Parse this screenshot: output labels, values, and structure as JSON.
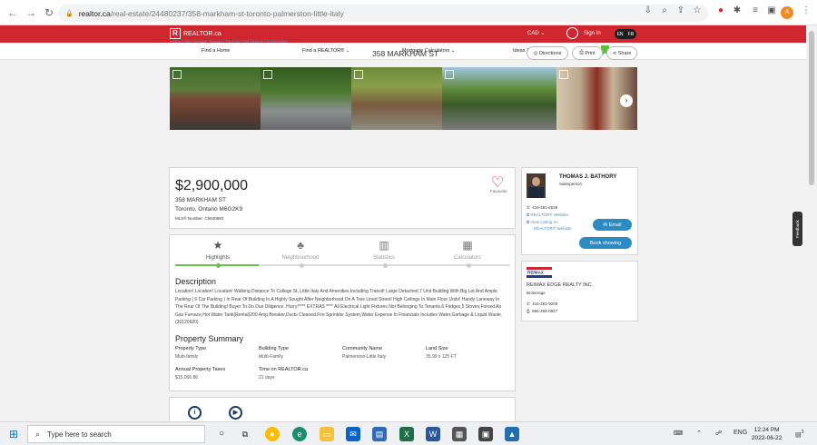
{
  "browser": {
    "url_host": "realtor.ca",
    "url_path": "/real-estate/24480237/358-markham-st-toronto-palmerston-little-italy",
    "profile_initial": "A"
  },
  "header": {
    "logo_text": "REALTOR.ca",
    "logo_letter": "R",
    "currency": "CAD",
    "sign_in": "Sign In",
    "lang_en": "EN",
    "lang_fr": "FR"
  },
  "menu": {
    "items": [
      "Find a Home",
      "Find a REALTOR®",
      "Mortgage Calculators",
      "Ideas & How-to"
    ]
  },
  "breadcrumb": [
    "Home",
    "ON",
    "Greater Toronto",
    "Toronto",
    "Old Toronto",
    "Palmerston"
  ],
  "listing": {
    "title": "358 MARKHAM ST",
    "actions": {
      "directions": "Directions",
      "print": "Print",
      "share": "Share"
    },
    "price": "$2,900,000",
    "address_line1": "358 MARKHAM ST",
    "address_line2": "Toronto, Ontario M6G2K9",
    "mls": "MLS® Number: C5640683",
    "favourite": "Favourite"
  },
  "tabs": [
    {
      "label": "Highlights",
      "icon": "star-icon"
    },
    {
      "label": "Neighbourhood",
      "icon": "trees-icon"
    },
    {
      "label": "Statistics",
      "icon": "bar-chart-icon"
    },
    {
      "label": "Calculators",
      "icon": "calculator-icon"
    }
  ],
  "description": {
    "heading": "Description",
    "text": "Location! Location! Location! Walking Distance To College St, Little Italy And Amenities Including Transit! Large Detached 7 Unit Building With Big Lot And Ample Parking ( 6 Car Parking ) In Rear Of Building In A Highly Sought After Neighborhood On A Tree Lined Street! High Ceilings In Main Floor Units! Handy Laneway In The Rear Of The Building! Buyer To Do Due Diligence. Hurry!**** EXTRAS **** All Electrical Light Fixtures Not Belonging To Tenants,6 Fridges,5 Stoves,Forced Air Gas Furnace,Hot Water Tank(Rental)200 Amp Breaker,Ducts Cleaned.Fire Sprinkler System,Water Expense In Financials Includes Water,Garbage & Liquid Waste. (30120920)"
  },
  "summary": {
    "heading": "Property Summary",
    "items": [
      {
        "label": "Property Type",
        "value": "Multi-family"
      },
      {
        "label": "Building Type",
        "value": "Multi-Family"
      },
      {
        "label": "Community Name",
        "value": "Palmerston-Little Italy"
      },
      {
        "label": "Land Size",
        "value": "35.99 x 125 FT"
      },
      {
        "label": "Annual Property Taxes",
        "value": "$15,066.86"
      },
      {
        "label": "Time on REALTOR.ca",
        "value": "21 days"
      }
    ]
  },
  "agent": {
    "name": "THOMAS J. BATHORY",
    "role": "Salesperson",
    "phone": "416-281-6528",
    "website": "REALTOR® Website",
    "view_listing_1": "View Listing on",
    "view_listing_2": "REALTOR® Website",
    "email_btn": "Email",
    "book_btn": "Book showing"
  },
  "brokerage": {
    "name": "RE/MAX EDGE REALTY INC.",
    "type": "Brokerage",
    "logo_text": "RE/MAX",
    "phone": "416-281-9200",
    "fax": "866-268-0947"
  },
  "feedback": "Feedback",
  "taskbar": {
    "search_placeholder": "Type here to search",
    "time": "12:24 PM",
    "date": "2022-06-22",
    "lang": "ENG",
    "notifications": "3"
  },
  "colors": {
    "brand_red": "#d0262f",
    "green": "#6cbf4a",
    "link_blue": "#2b8cc4"
  }
}
